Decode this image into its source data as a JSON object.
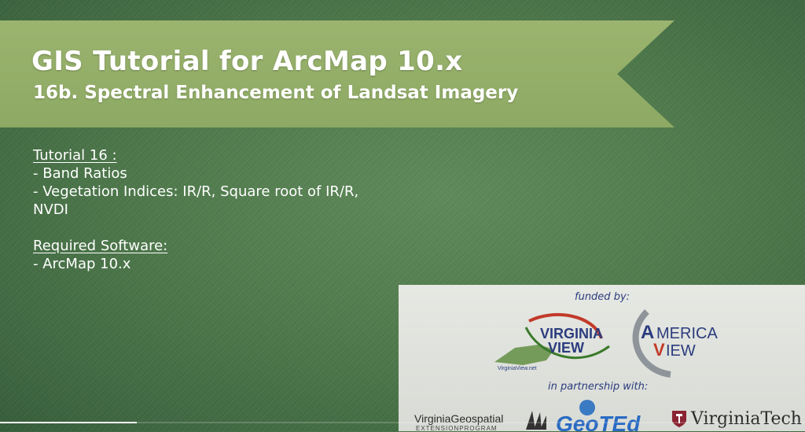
{
  "banner": {
    "title": "GIS Tutorial for ArcMap 10.x",
    "subtitle": "16b. Spectral Enhancement of Landsat Imagery"
  },
  "content": {
    "tutorial_heading": "Tutorial 16 :",
    "tutorial_items": [
      "- Band Ratios",
      "- Vegetation Indices: IR/R, Square root of IR/R,",
      "NVDI"
    ],
    "software_heading": "Required Software:",
    "software_items": [
      "- ArcMap 10.x"
    ]
  },
  "sponsors": {
    "funded_label": "funded by:",
    "partnership_label": "in partnership with:",
    "virginia_view": {
      "line1": "VIRGINIA",
      "line2": "VIEW",
      "url": "VirginiaView.net"
    },
    "america_view": {
      "line1": "MERICA",
      "line2": "VIEW",
      "initial_a": "A",
      "initial_v": "V"
    },
    "vge": {
      "name": "VirginiaGeospatial",
      "sub": "EXTENSIONPROGRAM"
    },
    "geoted": "GeoTEd",
    "vt": "VirginiaTech"
  },
  "colors": {
    "ribbon": "#8da963",
    "background": "#4f7a4c",
    "sponsor_text": "#2b3c7e"
  },
  "playback": {
    "progress_fraction": 0.17
  }
}
